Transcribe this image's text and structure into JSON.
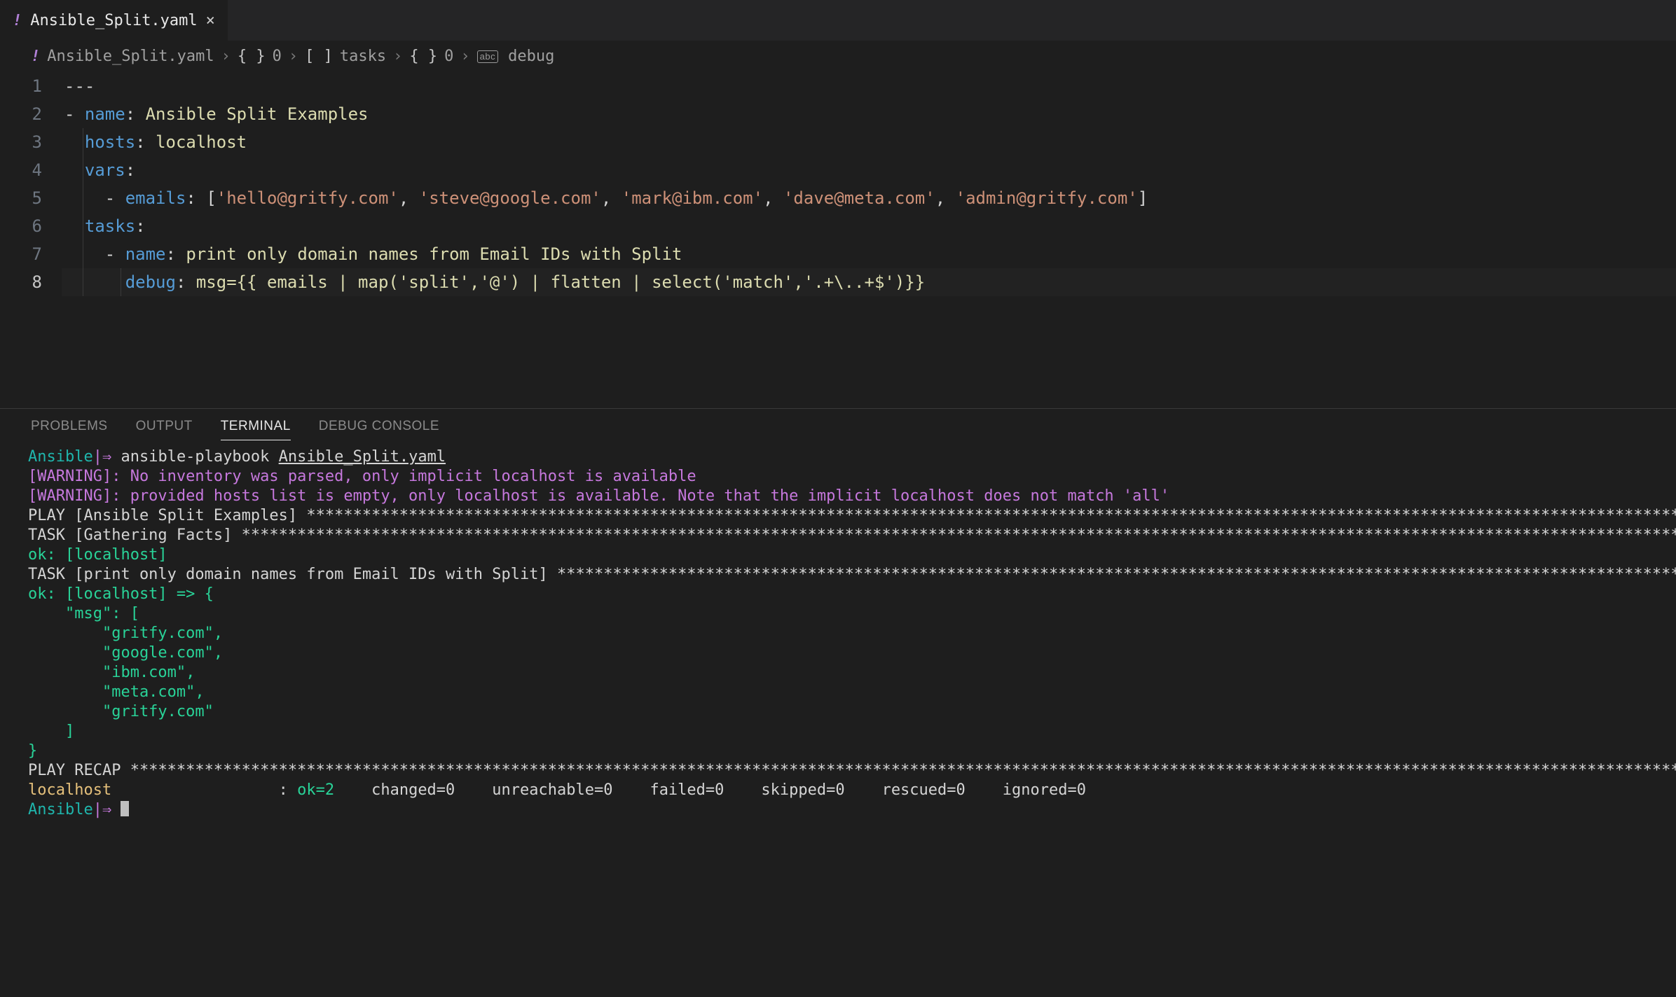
{
  "tab": {
    "filename": "Ansible_Split.yaml",
    "close": "×"
  },
  "breadcrumb": {
    "file": "Ansible_Split.yaml",
    "seg1": "0",
    "seg2": "tasks",
    "seg3": "0",
    "seg4": "debug"
  },
  "editor": {
    "line_numbers": [
      "1",
      "2",
      "3",
      "4",
      "5",
      "6",
      "7",
      "8"
    ],
    "active_line": 8,
    "lines": {
      "l1": "---",
      "l2_name_key": "name",
      "l2_name_val": "Ansible Split Examples",
      "l3_hosts_key": "hosts",
      "l3_hosts_val": "localhost",
      "l4_vars_key": "vars",
      "l5_emails_key": "emails",
      "l5_emails_vals": [
        "'hello@gritfy.com'",
        "'steve@google.com'",
        "'mark@ibm.com'",
        "'dave@meta.com'",
        "'admin@gritfy.com'"
      ],
      "l6_tasks_key": "tasks",
      "l7_name_key": "name",
      "l7_name_val": "print only domain names from Email IDs with Split",
      "l8_debug_key": "debug",
      "l8_debug_val": "msg={{ emails | map('split','@') | flatten | select('match','.+\\..+$')}}"
    }
  },
  "panel": {
    "tabs": {
      "problems": "PROBLEMS",
      "output": "OUTPUT",
      "terminal": "TERMINAL",
      "debug_console": "DEBUG CONSOLE"
    }
  },
  "terminal": {
    "prompt_label": "Ansible",
    "prompt_arrow": "|⇒ ",
    "command": "ansible-playbook ",
    "command_arg": "Ansible_Split.yaml",
    "warn1": "[WARNING]: No inventory was parsed, only implicit localhost is available",
    "warn2": "[WARNING]: provided hosts list is empty, only localhost is available. Note that the implicit localhost does not match 'all'",
    "play_header": "PLAY [Ansible Split Examples] ",
    "task1_header": "TASK [Gathering Facts] ",
    "task1_ok": "ok: [localhost]",
    "task2_header": "TASK [print only domain names from Email IDs with Split] ",
    "task2_ok_open": "ok: [localhost] => {",
    "msg_key": "    \"msg\": [",
    "msg_items": [
      "        \"gritfy.com\",",
      "        \"google.com\",",
      "        \"ibm.com\",",
      "        \"meta.com\",",
      "        \"gritfy.com\""
    ],
    "msg_close1": "    ]",
    "msg_close2": "}",
    "recap_header": "PLAY RECAP ",
    "recap_host": "localhost",
    "recap_colon": "                  : ",
    "recap_ok": "ok=2   ",
    "recap_rest": " changed=0    unreachable=0    failed=0    skipped=0    rescued=0    ignored=0   ",
    "stars_long": "******************************************************************************************************************************************************************************",
    "stars_med": "*************************************************************************************************************************************************************************************",
    "stars_short": "***********************************************************************************************************************************************",
    "stars_recap": "*********************************************************************************************************************************************************************************************"
  }
}
